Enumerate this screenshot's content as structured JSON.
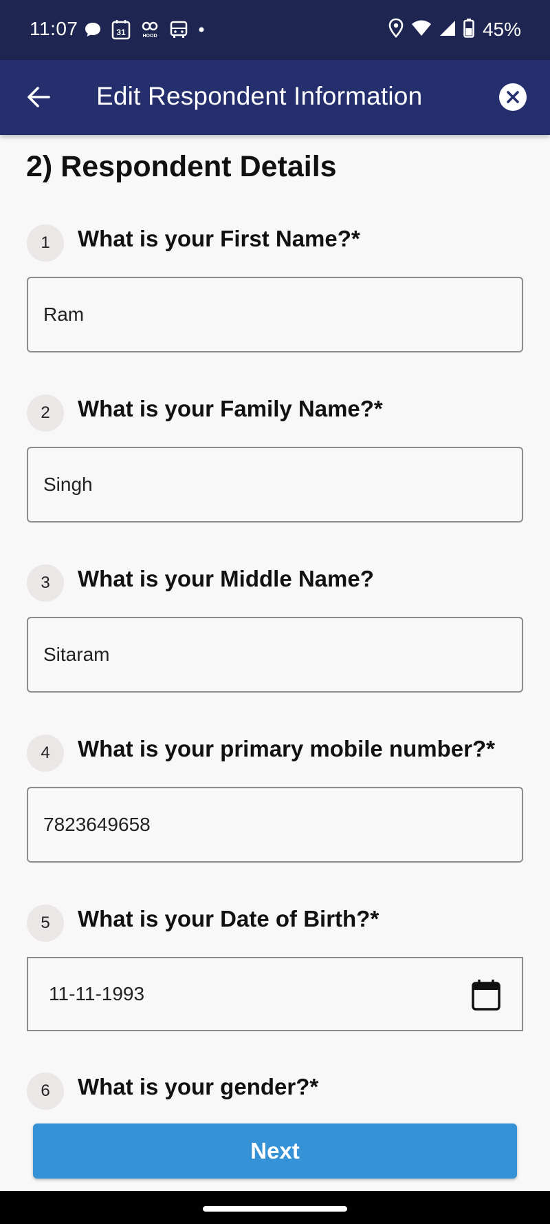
{
  "status_bar": {
    "time": "11:07",
    "left_icons": [
      "chat-bubble-icon",
      "calendar-31-icon",
      "hood-icon",
      "bus-icon",
      "dot-icon"
    ],
    "calendar_day": "31",
    "hood_label": "HOOD",
    "right_icons": [
      "location-icon",
      "wifi-icon",
      "signal-icon",
      "battery-icon"
    ],
    "battery": "45%"
  },
  "app_bar": {
    "title": "Edit Respondent Information",
    "back_icon": "arrow-left-icon",
    "close_icon": "close-circle-icon"
  },
  "section": {
    "title": "2) Respondent Details"
  },
  "questions": [
    {
      "number": "1",
      "label": "What is your First Name?*",
      "value": "Ram"
    },
    {
      "number": "2",
      "label": "What is your Family Name?*",
      "value": "Singh"
    },
    {
      "number": "3",
      "label": "What is your Middle Name?",
      "value": "Sitaram"
    },
    {
      "number": "4",
      "label": "What is your primary mobile number?*",
      "value": "7823649658"
    },
    {
      "number": "5",
      "label": "What is your Date of Birth?*",
      "value": "11-11-1993",
      "icon": "calendar-icon"
    },
    {
      "number": "6",
      "label": "What is your gender?*"
    }
  ],
  "footer": {
    "next_label": "Next"
  },
  "colors": {
    "status_bar": "#1d2550",
    "app_bar": "#262f6e",
    "primary_button": "#3592d6",
    "background": "#f8f8f8"
  }
}
